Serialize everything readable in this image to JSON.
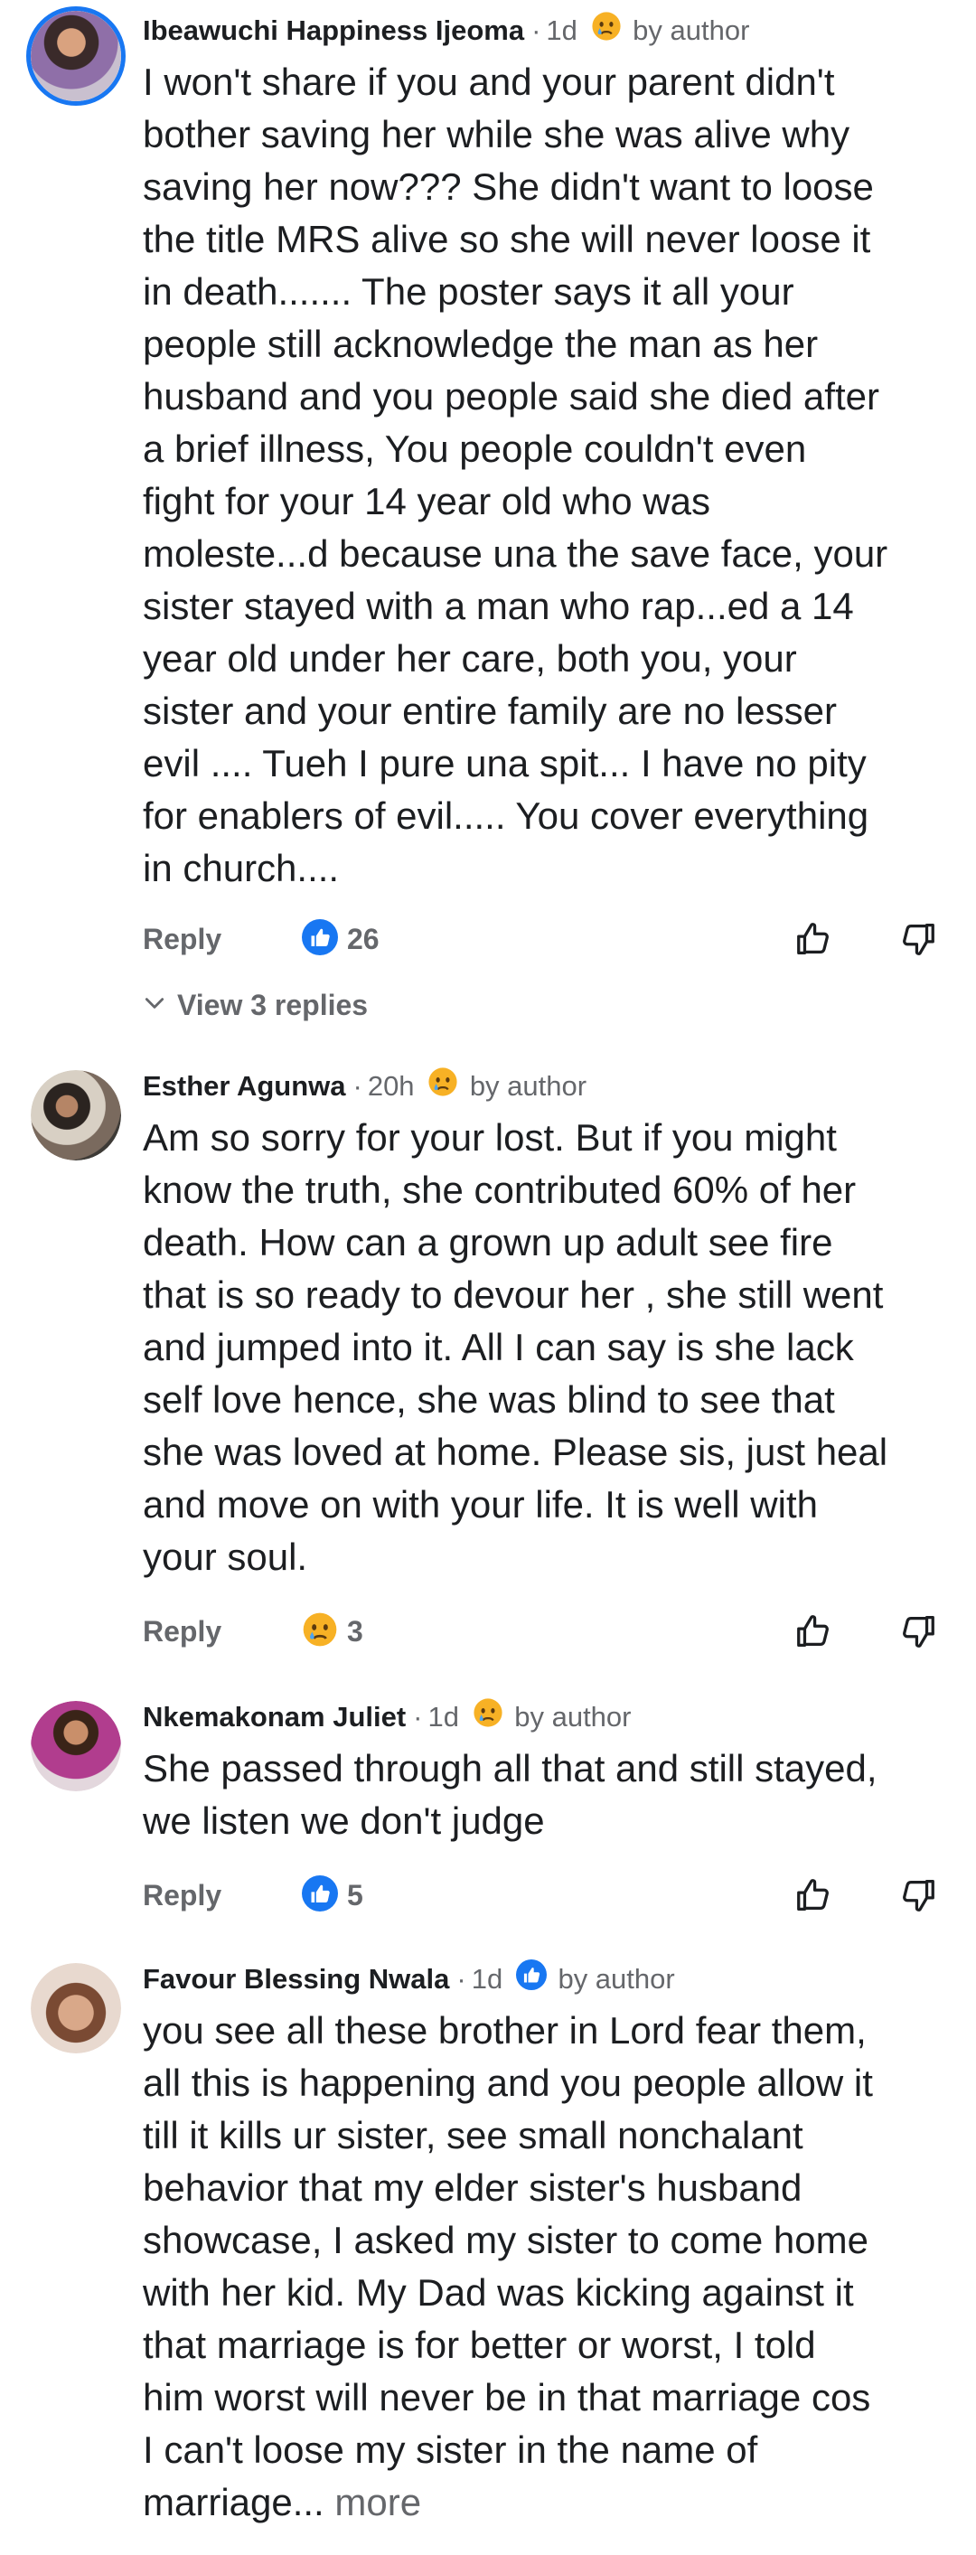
{
  "comments": [
    {
      "author": "Ibeawuchi Happiness Ijeoma",
      "time": "1d",
      "badge_reaction": "sad",
      "badge_label": "by author",
      "lines": [
        "I won't share if you and your parent didn't",
        "bother saving her while she was alive why",
        "saving her now??? She didn't want to loose",
        "the title MRS alive so she will never loose it",
        "in death....... The poster says it all your",
        "people still acknowledge the man as her",
        "husband and you people said she died after",
        "a brief illness, You people couldn't even",
        "fight for your 14 year old who was",
        "moleste...d because una the save face, your",
        "sister stayed with a man who rap...ed  a 14",
        "year old under her care, both you, your",
        "sister and your entire family are no lesser",
        "evil .... Tueh I pure una spit... I have no pity",
        "for enablers of evil..... You cover everything",
        "in church...."
      ],
      "reply_label": "Reply",
      "reaction_type": "like",
      "reaction_count": "26",
      "view_replies": "View 3 replies"
    },
    {
      "author": "Esther Agunwa",
      "time": "20h",
      "badge_reaction": "sad",
      "badge_label": "by author",
      "lines": [
        "Am so sorry for your lost. But if you might",
        "know the truth, she contributed 60% of her",
        "death. How can a grown up adult see fire",
        "that is so ready to devour her , she still went",
        "and jumped into it. All I can say is she lack",
        "self love  hence, she was blind to see that",
        "she was loved at home. Please sis, just heal",
        "and move on with your life. It is well with",
        "your soul."
      ],
      "reply_label": "Reply",
      "reaction_type": "sad",
      "reaction_count": "3"
    },
    {
      "author": "Nkemakonam Juliet",
      "time": "1d",
      "badge_reaction": "sad",
      "badge_label": "by author",
      "lines": [
        "She passed through all that and still stayed,",
        "we listen we don't judge"
      ],
      "reply_label": "Reply",
      "reaction_type": "like",
      "reaction_count": "5"
    },
    {
      "author": "Favour Blessing Nwala",
      "time": "1d",
      "badge_reaction": "like",
      "badge_label": "by author",
      "lines": [
        "you see all these brother in Lord fear them,",
        "all this is happening and you people allow it",
        "till it kills ur sister,  see small nonchalant",
        "behavior that my elder sister's husband",
        "showcase, I asked my sister to come home",
        "with her kid. My Dad was kicking against it",
        "that marriage is for better or worst, I told",
        "him worst will never be in that marriage cos",
        "I can't loose my sister in the name of",
        "marriage..."
      ],
      "more_label": "more"
    }
  ],
  "colors": {
    "accent": "#1877f2",
    "muted": "#65676b",
    "text": "#1c1e21",
    "sad_face": "#f7b125"
  },
  "icons": {
    "like": "thumbs-up-icon",
    "dislike": "thumbs-down-icon",
    "sad": "sad-face-icon",
    "chevron": "chevron-down-icon"
  }
}
